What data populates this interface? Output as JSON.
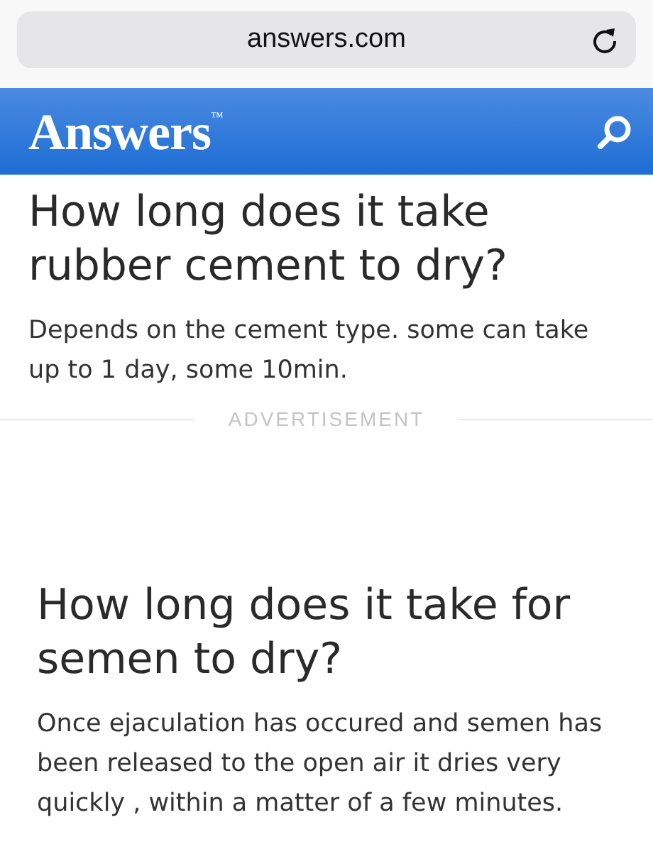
{
  "address_bar": {
    "url": "answers.com"
  },
  "header": {
    "logo": "Answers$^{™}$"
  },
  "questions": [
    {
      "title": "How long does it take rubber cement to dry?",
      "answer": "Depends on the cement type. some can take up to 1 day, some 10min.",
      "ad_label": "ADVERTISEMENT"
    },
    {
      "title": "How long does it take for semen to dry?",
      "answer": "Once ejaculation has occured and semen has been released to the open air it dries very quickly , within a matter of a few minutes."
    }
  ]
}
